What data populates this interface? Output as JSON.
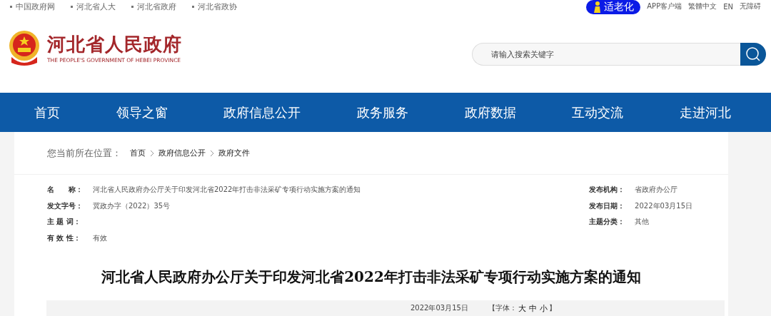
{
  "top_links": [
    "中国政府网",
    "河北省人大",
    "河北省政府",
    "河北省政协"
  ],
  "elder_mode_button": "适老化",
  "top_tools": [
    "APP客户端",
    "繁體中文",
    "EN",
    "无障碍"
  ],
  "site_title": "河北省人民政府",
  "site_subtitle": "THE PEOPLE'S GOVERNMENT OF HEBEI PROVINCE",
  "search": {
    "placeholder": "请输入搜索关键字"
  },
  "nav": [
    "首页",
    "领导之窗",
    "政府信息公开",
    "政务服务",
    "政府数据",
    "互动交流",
    "走进河北"
  ],
  "breadcrumb": {
    "label": "您当前所在位置：",
    "items": [
      "首页",
      "政府信息公开",
      "政府文件"
    ]
  },
  "meta_left": [
    {
      "label": "名　　称：",
      "value": "河北省人民政府办公厅关于印发河北省2022年打击非法采矿专项行动实施方案的通知"
    },
    {
      "label": "发文字号：",
      "value": "冀政办字（2022）35号"
    },
    {
      "label": "主 题 词："
    },
    {
      "label": "有 效 性：",
      "value": "有效"
    }
  ],
  "meta_right": [
    {
      "label": "发布机构：",
      "value": "省政府办公厅"
    },
    {
      "label": "发布日期：",
      "value": "2022年03月15日"
    },
    {
      "label": "主题分类：",
      "value": "其他"
    }
  ],
  "article": {
    "title": "河北省人民政府办公厅关于印发河北省2022年打击非法采矿专项行动实施方案的通知",
    "date": "2022年03月15日",
    "font_label": "【字体：",
    "font_sizes": [
      "大",
      "中",
      "小"
    ],
    "font_close": "】"
  }
}
